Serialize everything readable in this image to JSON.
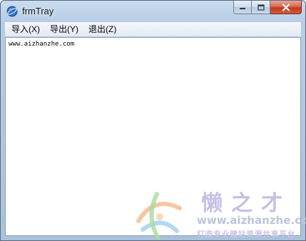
{
  "window": {
    "title": "frmTray"
  },
  "menu": {
    "items": [
      {
        "label": "导入(X)"
      },
      {
        "label": "导出(Y)"
      },
      {
        "label": "退出(Z)"
      }
    ]
  },
  "editor": {
    "content": "www.aizhanzhe.com"
  },
  "watermark": {
    "brand_cn": "懒之才",
    "url": "www.aizhanzhe.com",
    "slogan": "打造专业建站资源共享平台"
  },
  "colors": {
    "close_button": "#c4381d",
    "frame": "#b7cde6",
    "watermark": "#c6c1e6"
  }
}
